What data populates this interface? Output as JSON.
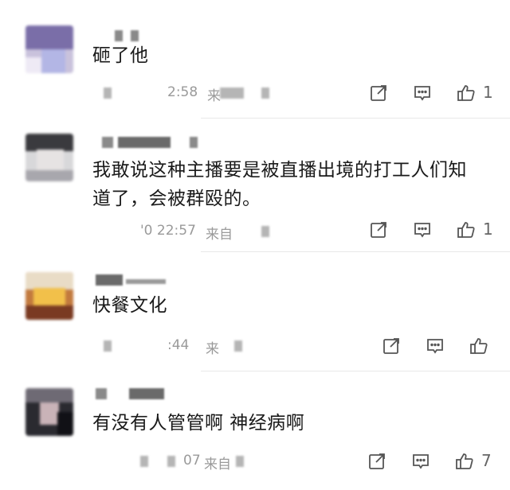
{
  "comments": [
    {
      "text_lines": [
        "砸了他"
      ],
      "time": "2:58",
      "time_suffix": "来",
      "likes": "1"
    },
    {
      "text_lines": [
        "我敢说这种主播要是被直播出境的打工人们知",
        "道了，会被群殴的。"
      ],
      "time": "'0 22:57",
      "time_suffix": "来自",
      "likes": "1"
    },
    {
      "text_lines": [
        "快餐文化"
      ],
      "time": ":44",
      "time_suffix": "来",
      "likes": ""
    },
    {
      "text_lines": [
        "有没有人管管啊  神经病啊"
      ],
      "time": "07",
      "time_suffix": "来自",
      "likes": "7"
    }
  ],
  "icons": {
    "share": "share-icon",
    "reply": "comment-icon",
    "like": "thumbs-up-icon"
  },
  "colors": {
    "icon": "#555555",
    "meta_text": "#9a9a9a",
    "body_text": "#1a1a1a"
  }
}
